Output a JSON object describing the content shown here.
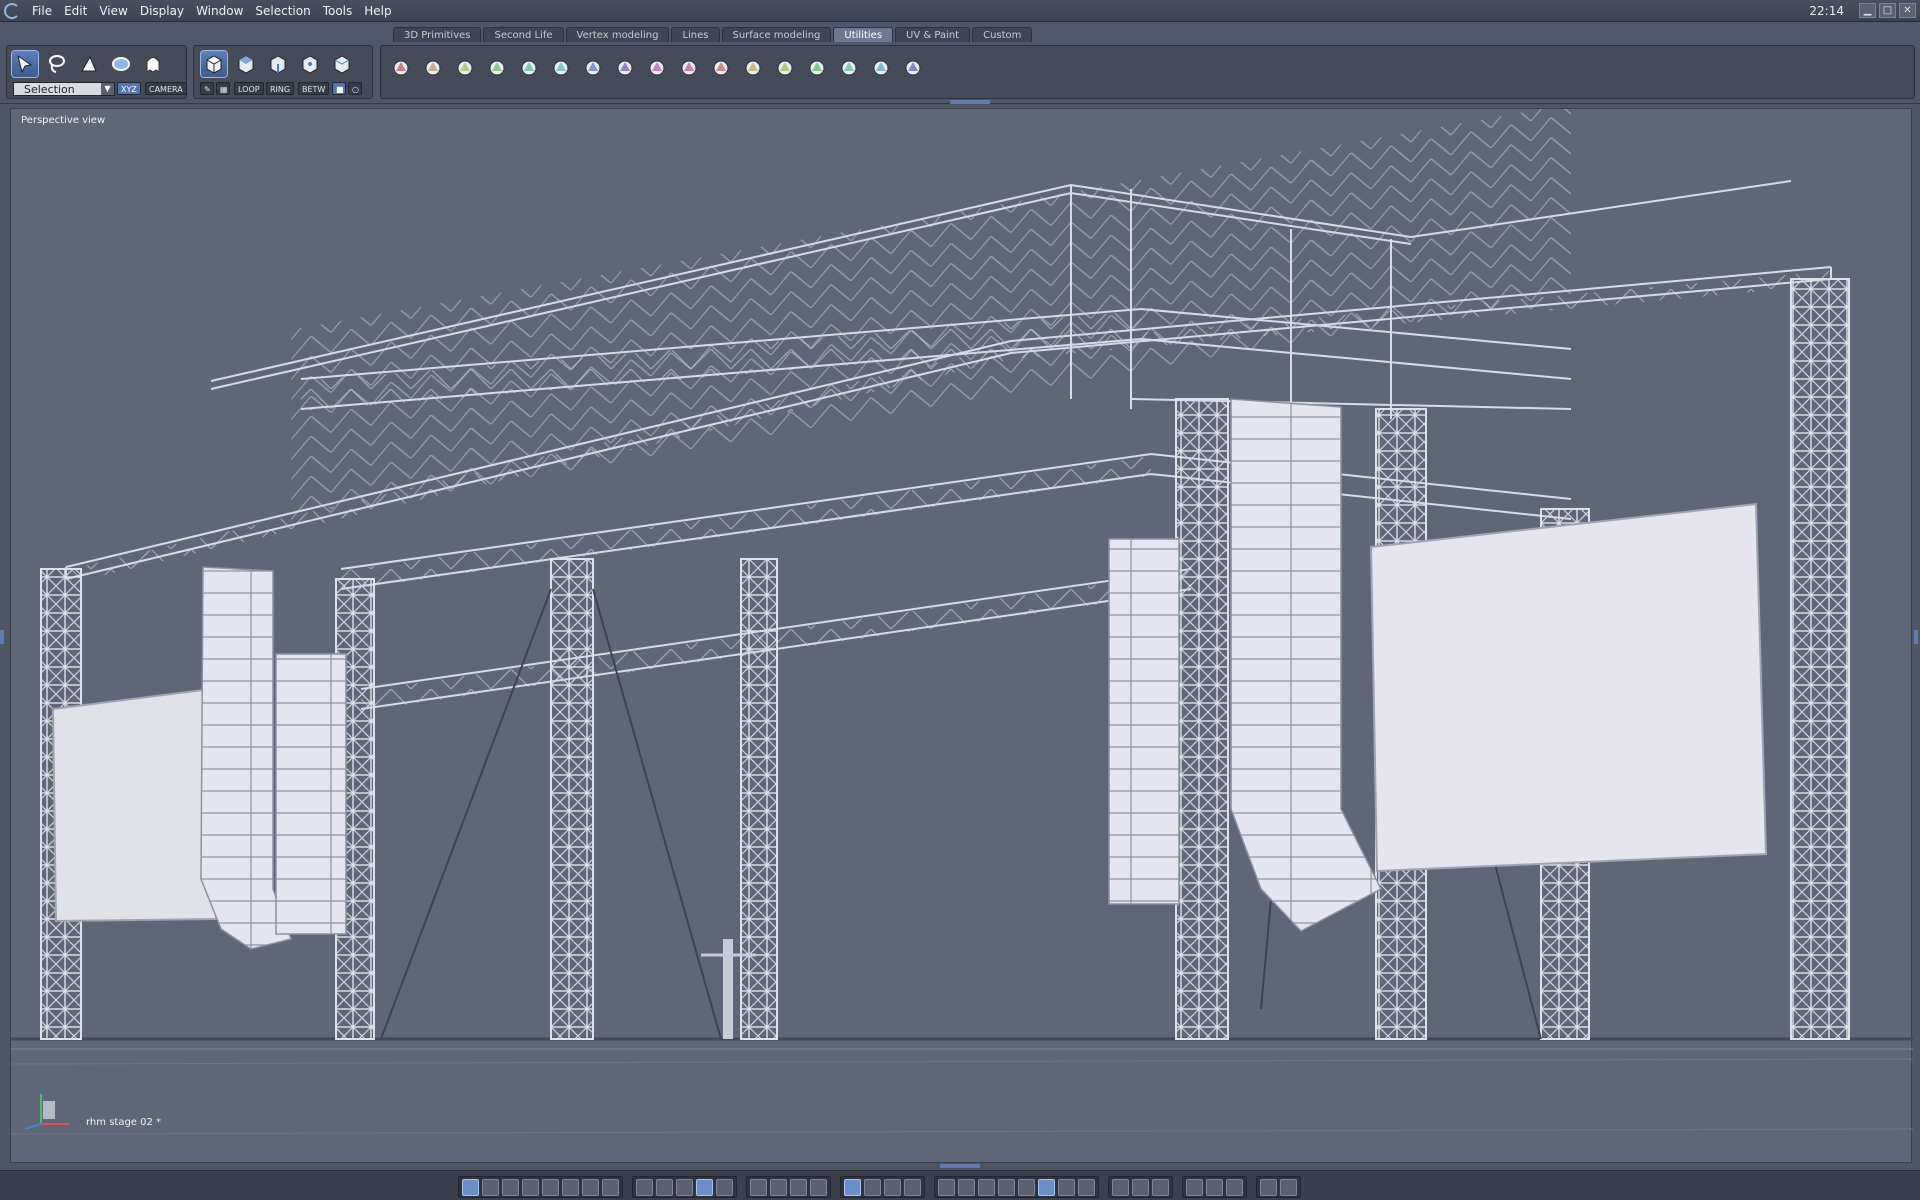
{
  "menubar": {
    "items": [
      "File",
      "Edit",
      "View",
      "Display",
      "Window",
      "Selection",
      "Tools",
      "Help"
    ],
    "clock": "22:14",
    "window_buttons": [
      "minimize",
      "maximize",
      "close"
    ]
  },
  "tabs": [
    "3D Primitives",
    "Second Life",
    "Vertex modeling",
    "Lines",
    "Surface modeling",
    "Utilities",
    "UV & Paint",
    "Custom"
  ],
  "active_tab": "Utilities",
  "selection_group": {
    "tools": [
      "select-arrow-icon",
      "lasso-icon",
      "paint-select-icon",
      "orb-select-icon",
      "ghost-select-icon"
    ],
    "dropdown_value": "Selection",
    "xyz_label": "XYZ",
    "camera_label": "CAMERA"
  },
  "mode_group": {
    "modes": [
      "object-mode-icon",
      "face-mode-icon",
      "edge-mode-icon",
      "vertex-mode-icon",
      "uv-mode-icon"
    ],
    "options": [
      "LOOP",
      "RING",
      "BETW"
    ]
  },
  "utilities_tools": [
    "tube-icon",
    "box-extrude-icon",
    "grid-cube-icon",
    "chain-icon",
    "multi-array-icon",
    "path-deform-icon",
    "cone-icon",
    "bend-icon",
    "link-icon",
    "chain-link-icon",
    "ghost-icon",
    "ghost-dark-icon",
    "globe-icon",
    "arrow-shape-icon",
    "gear-shape-icon",
    "cylinder-icon",
    "sky-icon"
  ],
  "viewport": {
    "label": "Perspective view",
    "document": "rhm stage 02 *"
  },
  "colors": {
    "viewport_bg": "#5f6677",
    "truss": "#d7dbe4",
    "screen": "#e2e2ea",
    "accent": "#5f7bb0"
  },
  "bottom_groups": [
    {
      "name": "layout-group",
      "icons": [
        "single-view-icon",
        "quad-view-icon",
        "split-h-icon",
        "split-v-icon",
        "triple-view-icon",
        "triple-view-2-icon",
        "dual-view-icon",
        "dual-view-2-icon"
      ]
    },
    {
      "name": "display-group",
      "icons": [
        "grid-icon",
        "brush-icon",
        "checker-icon",
        "stripes-icon",
        "table-icon"
      ]
    },
    {
      "name": "navigation-group",
      "icons": [
        "fit-icon",
        "pan-icon",
        "zoom-icon",
        "eye-icon"
      ]
    },
    {
      "name": "axis-group",
      "icons": [
        "axis-icon",
        "tripod-icon",
        "gizmo-icon",
        "move-down-icon"
      ]
    },
    {
      "name": "shading-group",
      "icons": [
        "wire-sphere-icon",
        "wire-sphere-2-icon",
        "shaded-sphere-icon",
        "smooth-sphere-icon",
        "gloss-sphere-icon",
        "textured-icon",
        "gray-sphere-icon",
        "white-sphere-icon"
      ]
    },
    {
      "name": "render-group",
      "icons": [
        "render-1-icon",
        "render-2-icon",
        "render-3-icon"
      ]
    },
    {
      "name": "export-group",
      "icons": [
        "cube-export-icon",
        "cube-2-icon",
        "cube-3-icon"
      ]
    },
    {
      "name": "camera-group",
      "icons": [
        "render-cam-icon",
        "camera-icon"
      ]
    }
  ]
}
